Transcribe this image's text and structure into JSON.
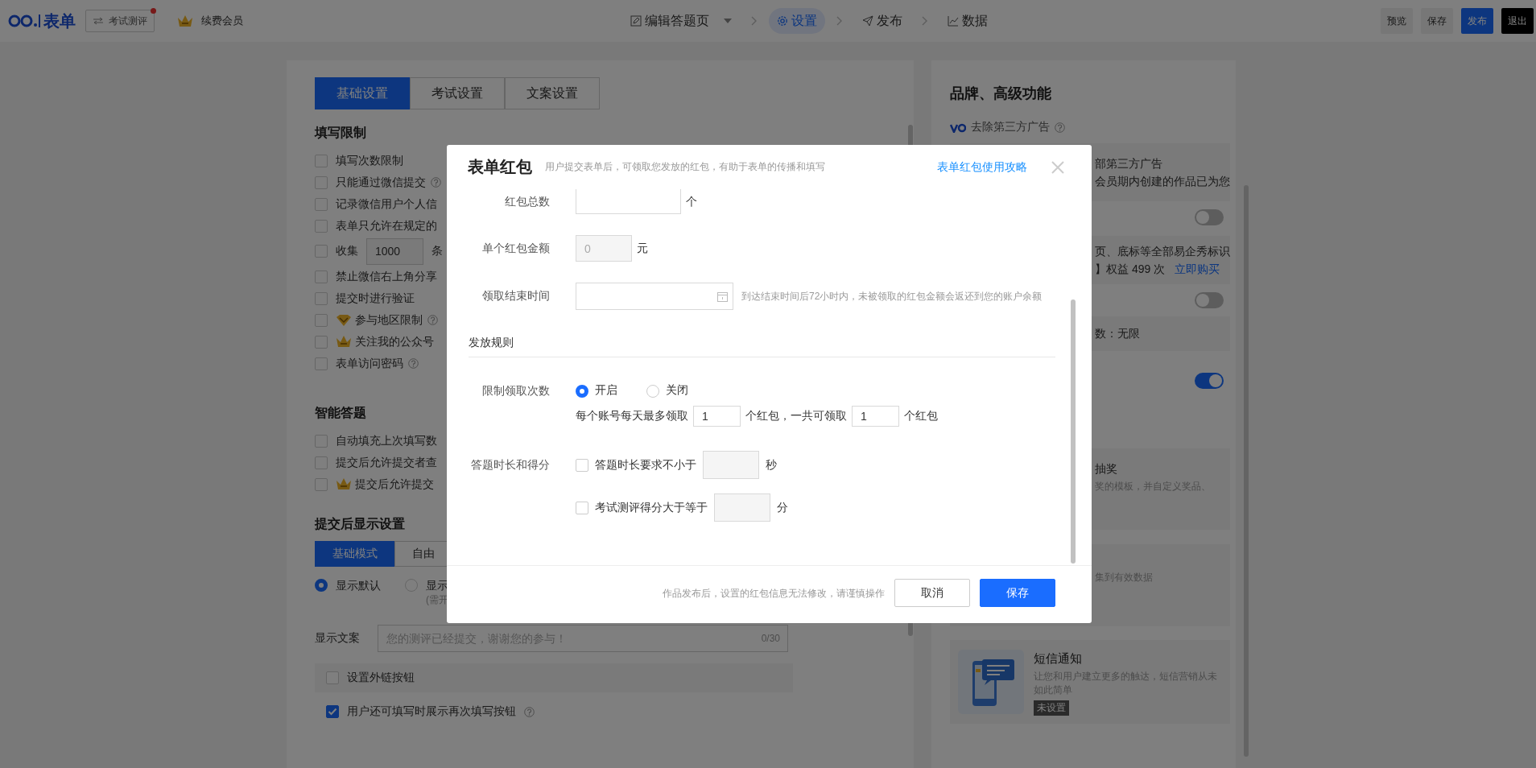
{
  "top_bar": {
    "logo": "表单",
    "mode_button": "考试测评",
    "vip_link": "续费会员",
    "steps": [
      {
        "kind": "edit",
        "label": "编辑答题页",
        "selected": false,
        "dropdown": true
      },
      {
        "kind": "settings",
        "label": "设置",
        "selected": true
      },
      {
        "kind": "publish",
        "label": "发布",
        "selected": false
      },
      {
        "kind": "data",
        "label": "数据",
        "selected": false
      }
    ],
    "actions": [
      {
        "kind": "plain",
        "label": "预览"
      },
      {
        "kind": "plain",
        "label": "保存"
      },
      {
        "kind": "primary",
        "label": "发布"
      },
      {
        "kind": "dark",
        "label": "退出"
      }
    ]
  },
  "left_panel": {
    "tabs": [
      {
        "label": "基础设置",
        "selected": true
      },
      {
        "label": "考试设置",
        "selected": false
      },
      {
        "label": "文案设置",
        "selected": false
      }
    ],
    "sections": [
      {
        "title": "填写限制",
        "options": [
          {
            "kind": "check",
            "label": "填写次数限制",
            "checked": false
          },
          {
            "kind": "check",
            "label": "只能通过微信提交",
            "checked": false,
            "help": true
          },
          {
            "kind": "check",
            "label": "记录微信用户个人信",
            "checked": false
          },
          {
            "kind": "check",
            "label": "表单只允许在规定的",
            "checked": false
          },
          {
            "kind": "collect",
            "label": "收集",
            "value": "1000",
            "unit": "条",
            "checked": false
          },
          {
            "kind": "check",
            "label": "禁止微信右上角分享",
            "checked": false
          },
          {
            "kind": "check",
            "label": "提交时进行验证",
            "checked": false
          },
          {
            "kind": "check",
            "label": "参与地区限制",
            "checked": false,
            "help": true,
            "vip_badge": true
          },
          {
            "kind": "check",
            "label": "关注我的公众号",
            "checked": false,
            "crown_badge": true
          },
          {
            "kind": "check",
            "label": "表单访问密码",
            "checked": false,
            "help": true
          }
        ]
      },
      {
        "title": "智能答题",
        "options": [
          {
            "kind": "check",
            "label": "自动填充上次填写数",
            "checked": false
          },
          {
            "kind": "check",
            "label": "提交后允许提交者查",
            "checked": false
          },
          {
            "kind": "check",
            "label": "提交后允许提交",
            "checked": false,
            "crown_badge": true
          }
        ]
      }
    ],
    "display": {
      "title": "提交后显示设置",
      "modes": [
        {
          "label": "基础模式",
          "selected": true
        },
        {
          "label": "自由",
          "selected": false
        }
      ],
      "options": [
        {
          "label": "显示默认",
          "selected": true
        },
        {
          "label": "显示",
          "note": "(需开",
          "selected": false
        }
      ],
      "text_label": "显示文案",
      "text_placeholder": "您的测评已经提交，谢谢您的参与！",
      "counter": "0/30",
      "link_option": {
        "label": "设置外链按钮",
        "checked": false
      },
      "refill_option": {
        "label": "用户还可填写时展示再次填写按钮",
        "checked": true,
        "help": true
      }
    }
  },
  "right_panel": {
    "title": "品牌、高级功能",
    "feature": "去除第三方广告",
    "items": [
      {
        "kind": "card",
        "lines": [
          {
            "text": "部第三方广告"
          },
          {
            "text": "会员期内创建的作品已为您"
          }
        ]
      },
      {
        "kind": "toggle",
        "on": false
      },
      {
        "kind": "card",
        "lines": [
          {
            "text": "页、底标等全部易企秀标识"
          },
          {
            "text": "】权益 499 次"
          }
        ],
        "link": "立即购买"
      },
      {
        "kind": "toggle",
        "on": false
      },
      {
        "kind": "card",
        "lines": [
          {
            "text": "数：无限"
          }
        ]
      },
      {
        "kind": "toggle",
        "on": true
      },
      {
        "kind": "card",
        "lines": [
          {
            "text": "抽奖"
          },
          {
            "text": "奖的模板，并自定义奖品、",
            "muted": true
          }
        ]
      },
      {
        "kind": "card",
        "lines": [
          {
            "text": "集到有效数据",
            "muted": true
          }
        ]
      },
      {
        "kind": "feature",
        "title": "短信通知",
        "desc": "让您和用户建立更多的触达，短信营销从未如此简单",
        "badge": "未设置"
      }
    ]
  },
  "modal": {
    "title": "表单红包",
    "subtitle": "用户提交表单后，可领取您发放的红包，有助于表单的传播和填写",
    "guide_link": "表单红包使用攻略",
    "fields": [
      {
        "kind": "count",
        "label": "红包总数",
        "unit": "个"
      },
      {
        "kind": "amount",
        "label": "单个红包金额",
        "value": "0",
        "unit": "元",
        "disabled": true
      },
      {
        "kind": "date",
        "label": "领取结束时间",
        "hint": "到达结束时间后72小时内，未被领取的红包金额会返还到您的账户余额"
      }
    ],
    "rules_title": "发放规则",
    "limit": {
      "label": "限制领取次数",
      "options": [
        {
          "label": "开启",
          "selected": true
        },
        {
          "label": "关闭",
          "selected": false
        }
      ],
      "sentence": [
        "每个账号每天最多领取",
        "个红包，一共可领取",
        "个红包"
      ],
      "daily": "1",
      "total": "1"
    },
    "duration": {
      "label": "答题时长和得分",
      "options": [
        {
          "label": "答题时长要求不小于",
          "unit": "秒",
          "checked": false
        },
        {
          "label": "考试测评得分大于等于",
          "unit": "分",
          "checked": false
        }
      ]
    },
    "footer": {
      "note": "作品发布后，设置的红包信息无法修改，请谨慎操作",
      "cancel": "取消",
      "save": "保存"
    }
  }
}
